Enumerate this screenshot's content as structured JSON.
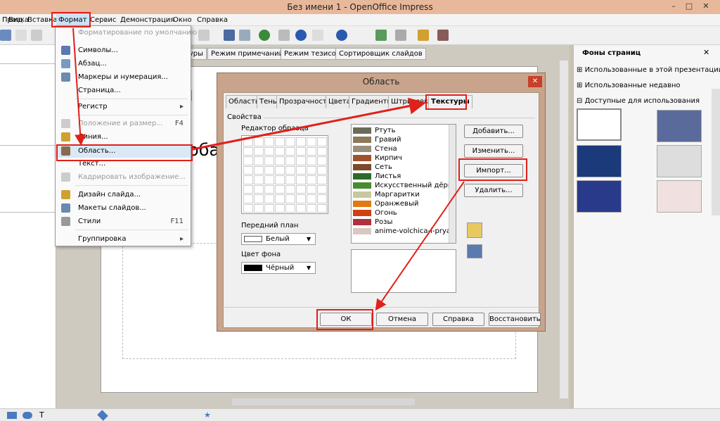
{
  "window": {
    "title": "Без имени 1 - OpenOffice Impress",
    "minimize": "–",
    "maximize": "□",
    "close": "✕"
  },
  "menubar": {
    "items": [
      "Правка",
      "Вид",
      "Вставка",
      "Формат",
      "Сервис",
      "Демонстрация",
      "Окно",
      "Справка"
    ]
  },
  "view_tabs": [
    "туры",
    "Режим примечаний",
    "Режим тезисов",
    "Сортировщик слайдов"
  ],
  "slide": {
    "text1": "ля",
    "text2": "оба"
  },
  "format_menu": {
    "items": [
      {
        "label": "Форматирование по умолчанию",
        "disabled": true
      },
      {
        "label": "Символы..."
      },
      {
        "label": "Абзац..."
      },
      {
        "label": "Маркеры и нумерация..."
      },
      {
        "label": "Страница..."
      },
      {
        "label": "Регистр",
        "submenu": "▸"
      },
      {
        "label": "Положение и размер...",
        "shortcut": "F4",
        "disabled": true
      },
      {
        "label": "Линия..."
      },
      {
        "label": "Область..."
      },
      {
        "label": "Текст..."
      },
      {
        "label": "Кадрировать изображение...",
        "disabled": true
      },
      {
        "label": "Дизайн слайда..."
      },
      {
        "label": "Макеты слайдов..."
      },
      {
        "label": "Стили",
        "shortcut": "F11"
      },
      {
        "label": "Группировка",
        "submenu": "▸"
      }
    ]
  },
  "dialog": {
    "title": "Область",
    "tabs": [
      "Область",
      "Тень",
      "Прозрачность",
      "Цвета",
      "Градиенты",
      "Штриховка",
      "Текстуры"
    ],
    "group_label": "Свойства",
    "editor_label": "Редактор образца",
    "textures": [
      "Ртуть",
      "Гравий",
      "Стена",
      "Кирпич",
      "Сеть",
      "Листья",
      "Искусственный дёрн",
      "Маргаритки",
      "Оранжевый",
      "Огонь",
      "Розы",
      "anime-volchica-i-pryan"
    ],
    "texture_colors": [
      "#6b6b5a",
      "#8c7a5a",
      "#9a8f7a",
      "#a0522d",
      "#7a4a2a",
      "#2e6b2a",
      "#4a8a30",
      "#c8c8a0",
      "#e07a10",
      "#d04010",
      "#b03040",
      "#d8c8c0"
    ],
    "foreground_label": "Передний план",
    "foreground_value": "Белый",
    "background_label": "Цвет фона",
    "background_value": "Чёрный",
    "buttons": {
      "add": "Добавить...",
      "modify": "Изменить...",
      "import": "Импорт...",
      "delete": "Удалить...",
      "ok": "ОК",
      "cancel": "Отмена",
      "help": "Справка",
      "reset": "Восстановить"
    }
  },
  "right_panel": {
    "title": "Фоны страниц",
    "close": "✕",
    "sections": [
      "Использованные в этой презентации",
      "Использованные недавно",
      "Доступные для использования"
    ]
  },
  "colors": {
    "highlight": "#e0201a",
    "title_bar": "#e8b89a",
    "dialog_frame": "#c9a48c"
  }
}
